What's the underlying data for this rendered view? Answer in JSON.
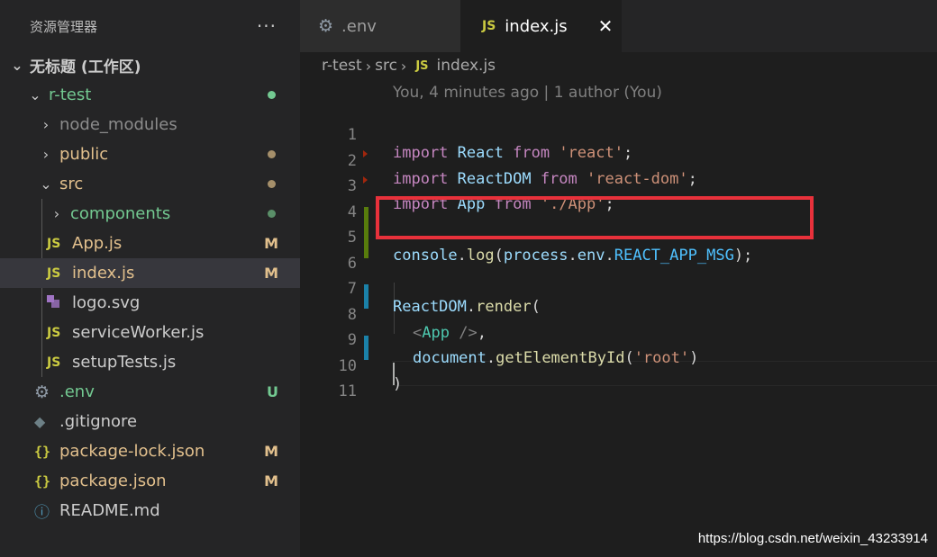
{
  "sidebar": {
    "title": "资源管理器",
    "more": "···",
    "workspace": "无标题 (工作区)",
    "folder": "r-test",
    "items": [
      {
        "label": "node_modules",
        "badge": ""
      },
      {
        "label": "public",
        "badge": ""
      },
      {
        "label": "src",
        "badge": ""
      },
      {
        "label": "components",
        "badge": ""
      },
      {
        "label": "App.js",
        "badge": "M"
      },
      {
        "label": "index.js",
        "badge": "M"
      },
      {
        "label": "logo.svg",
        "badge": ""
      },
      {
        "label": "serviceWorker.js",
        "badge": ""
      },
      {
        "label": "setupTests.js",
        "badge": ""
      },
      {
        "label": ".env",
        "badge": "U"
      },
      {
        "label": ".gitignore",
        "badge": ""
      },
      {
        "label": "package-lock.json",
        "badge": "M"
      },
      {
        "label": "package.json",
        "badge": "M"
      },
      {
        "label": "README.md",
        "badge": ""
      }
    ]
  },
  "icons": {
    "js": "JS",
    "json": "{}",
    "gear": "⚙",
    "git": "◆",
    "info": "ⓘ",
    "chevron_right": "›",
    "chevron_down": "⌄"
  },
  "tabs": [
    {
      "label": ".env"
    },
    {
      "label": "index.js",
      "close": "✕"
    }
  ],
  "breadcrumb": [
    "r-test",
    "src",
    "index.js"
  ],
  "editor": {
    "blame": "You, 4 minutes ago | 1 author (You)",
    "line_numbers": [
      "1",
      "2",
      "3",
      "4",
      "5",
      "6",
      "7",
      "8",
      "9",
      "10",
      "11"
    ]
  },
  "colors": {
    "accent_modified": "#e2c08d",
    "untracked": "#73c991",
    "highlight_box": "#e8313b"
  },
  "watermark": "https://blog.csdn.net/weixin_43233914"
}
